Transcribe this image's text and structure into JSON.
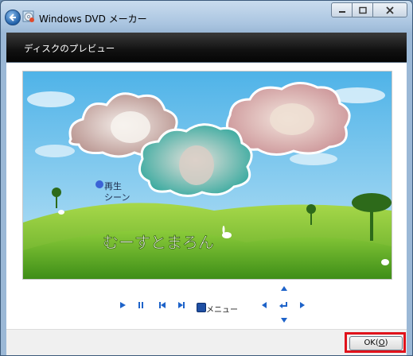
{
  "window": {
    "title": "Windows DVD メーカー"
  },
  "header": {
    "title": "ディスクのプレビュー"
  },
  "preview": {
    "menu_text": "再生",
    "menu_text2": "シーン",
    "disc_title": "むーすとまろん"
  },
  "controls": {
    "menu_label": "メニュー"
  },
  "footer": {
    "ok_label": "OK(",
    "ok_key": "O",
    "ok_close": ")"
  },
  "colors": {
    "sky": "#5db9e8",
    "grass": "#7dc23a",
    "accent": "#e0121b"
  }
}
